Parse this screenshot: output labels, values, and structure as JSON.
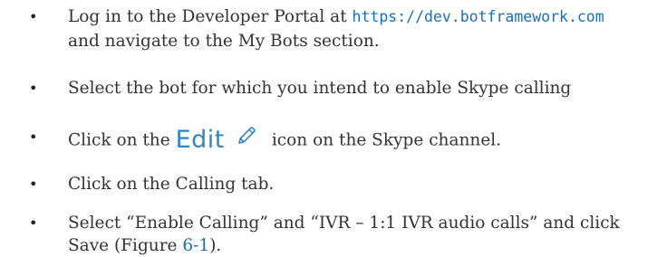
{
  "bullets": [
    {
      "line1_pre": "Log in to the Developer Portal at ",
      "line1_url": "https://dev.botframework.com",
      "line2": "and navigate to the My Bots section."
    },
    {
      "text": "Select the bot for which you intend to enable Skype calling"
    },
    {
      "pre": "Click on the ",
      "edit_label": "Edit",
      "icon": "pencil-icon",
      "post": "icon on the Skype channel."
    },
    {
      "text": "Click on the Calling tab."
    },
    {
      "line1": "Select “Enable Calling” and “IVR – 1:1 IVR audio calls” and click",
      "line2_pre": "Save (Figure ",
      "line2_link": "6-1",
      "line2_post": ")."
    }
  ],
  "bullet_char": "•",
  "colors": {
    "text": "#333333",
    "link": "#1a6fb8",
    "edit": "#2f86c9"
  }
}
